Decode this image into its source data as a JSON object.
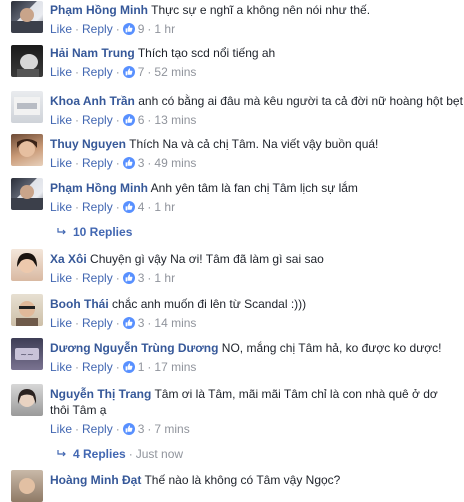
{
  "actions": {
    "like": "Like",
    "reply": "Reply",
    "dot": "·"
  },
  "comments": [
    {
      "name": "Phạm Hồng Minh",
      "text": "Thực sự e nghĩ a không nên nói như thế.",
      "likes": "9",
      "time": "1 hr"
    },
    {
      "name": "Hải Nam Trung",
      "text": "Thích tạo scd nổi tiếng ah",
      "likes": "7",
      "time": "52 mins"
    },
    {
      "name": "Khoa Anh Trần",
      "text": "anh có bằng ai đâu mà kêu người ta cả đời nữ hoàng hột bẹt",
      "likes": "6",
      "time": "13 mins"
    },
    {
      "name": "Thuy Nguyen",
      "text": "Thích Na và cả chị Tâm. Na viết vậy buồn quá!",
      "likes": "3",
      "time": "49 mins"
    },
    {
      "name": "Phạm Hồng Minh",
      "text": "Anh yên tâm là fan chị Tâm lịch sự lắm",
      "likes": "4",
      "time": "1 hr"
    },
    {
      "name": "Xa Xôi",
      "text": "Chuyện gì vậy Na ơi! Tâm đã làm gì sai sao",
      "likes": "3",
      "time": "1 hr"
    },
    {
      "name": "Booh Thái",
      "text": "chắc anh muốn đi lên từ Scandal :)))",
      "likes": "3",
      "time": "14 mins"
    },
    {
      "name": "Dương Nguyễn Trùng Dương",
      "text": "NO, mắng chị Tâm hả, ko được ko dược!",
      "likes": "1",
      "time": "17 mins"
    },
    {
      "name": "Nguyễn Thị Trang",
      "text": "Tâm ơi là Tâm, mãi mãi Tâm chỉ là con nhà quê ở dơ thôi Tâm ạ",
      "likes": "3",
      "time": "7 mins"
    },
    {
      "name": "Hoàng Minh Đạt",
      "text": "Thế nào là không có Tâm vậy Ngọc?"
    }
  ],
  "reply_threads": [
    {
      "label": "10 Replies"
    },
    {
      "label": "4 Replies",
      "time": "Just now"
    }
  ],
  "colors": {
    "link": "#365899",
    "action": "#4267b2",
    "meta": "#90949c",
    "like_badge": "#5890ff"
  }
}
